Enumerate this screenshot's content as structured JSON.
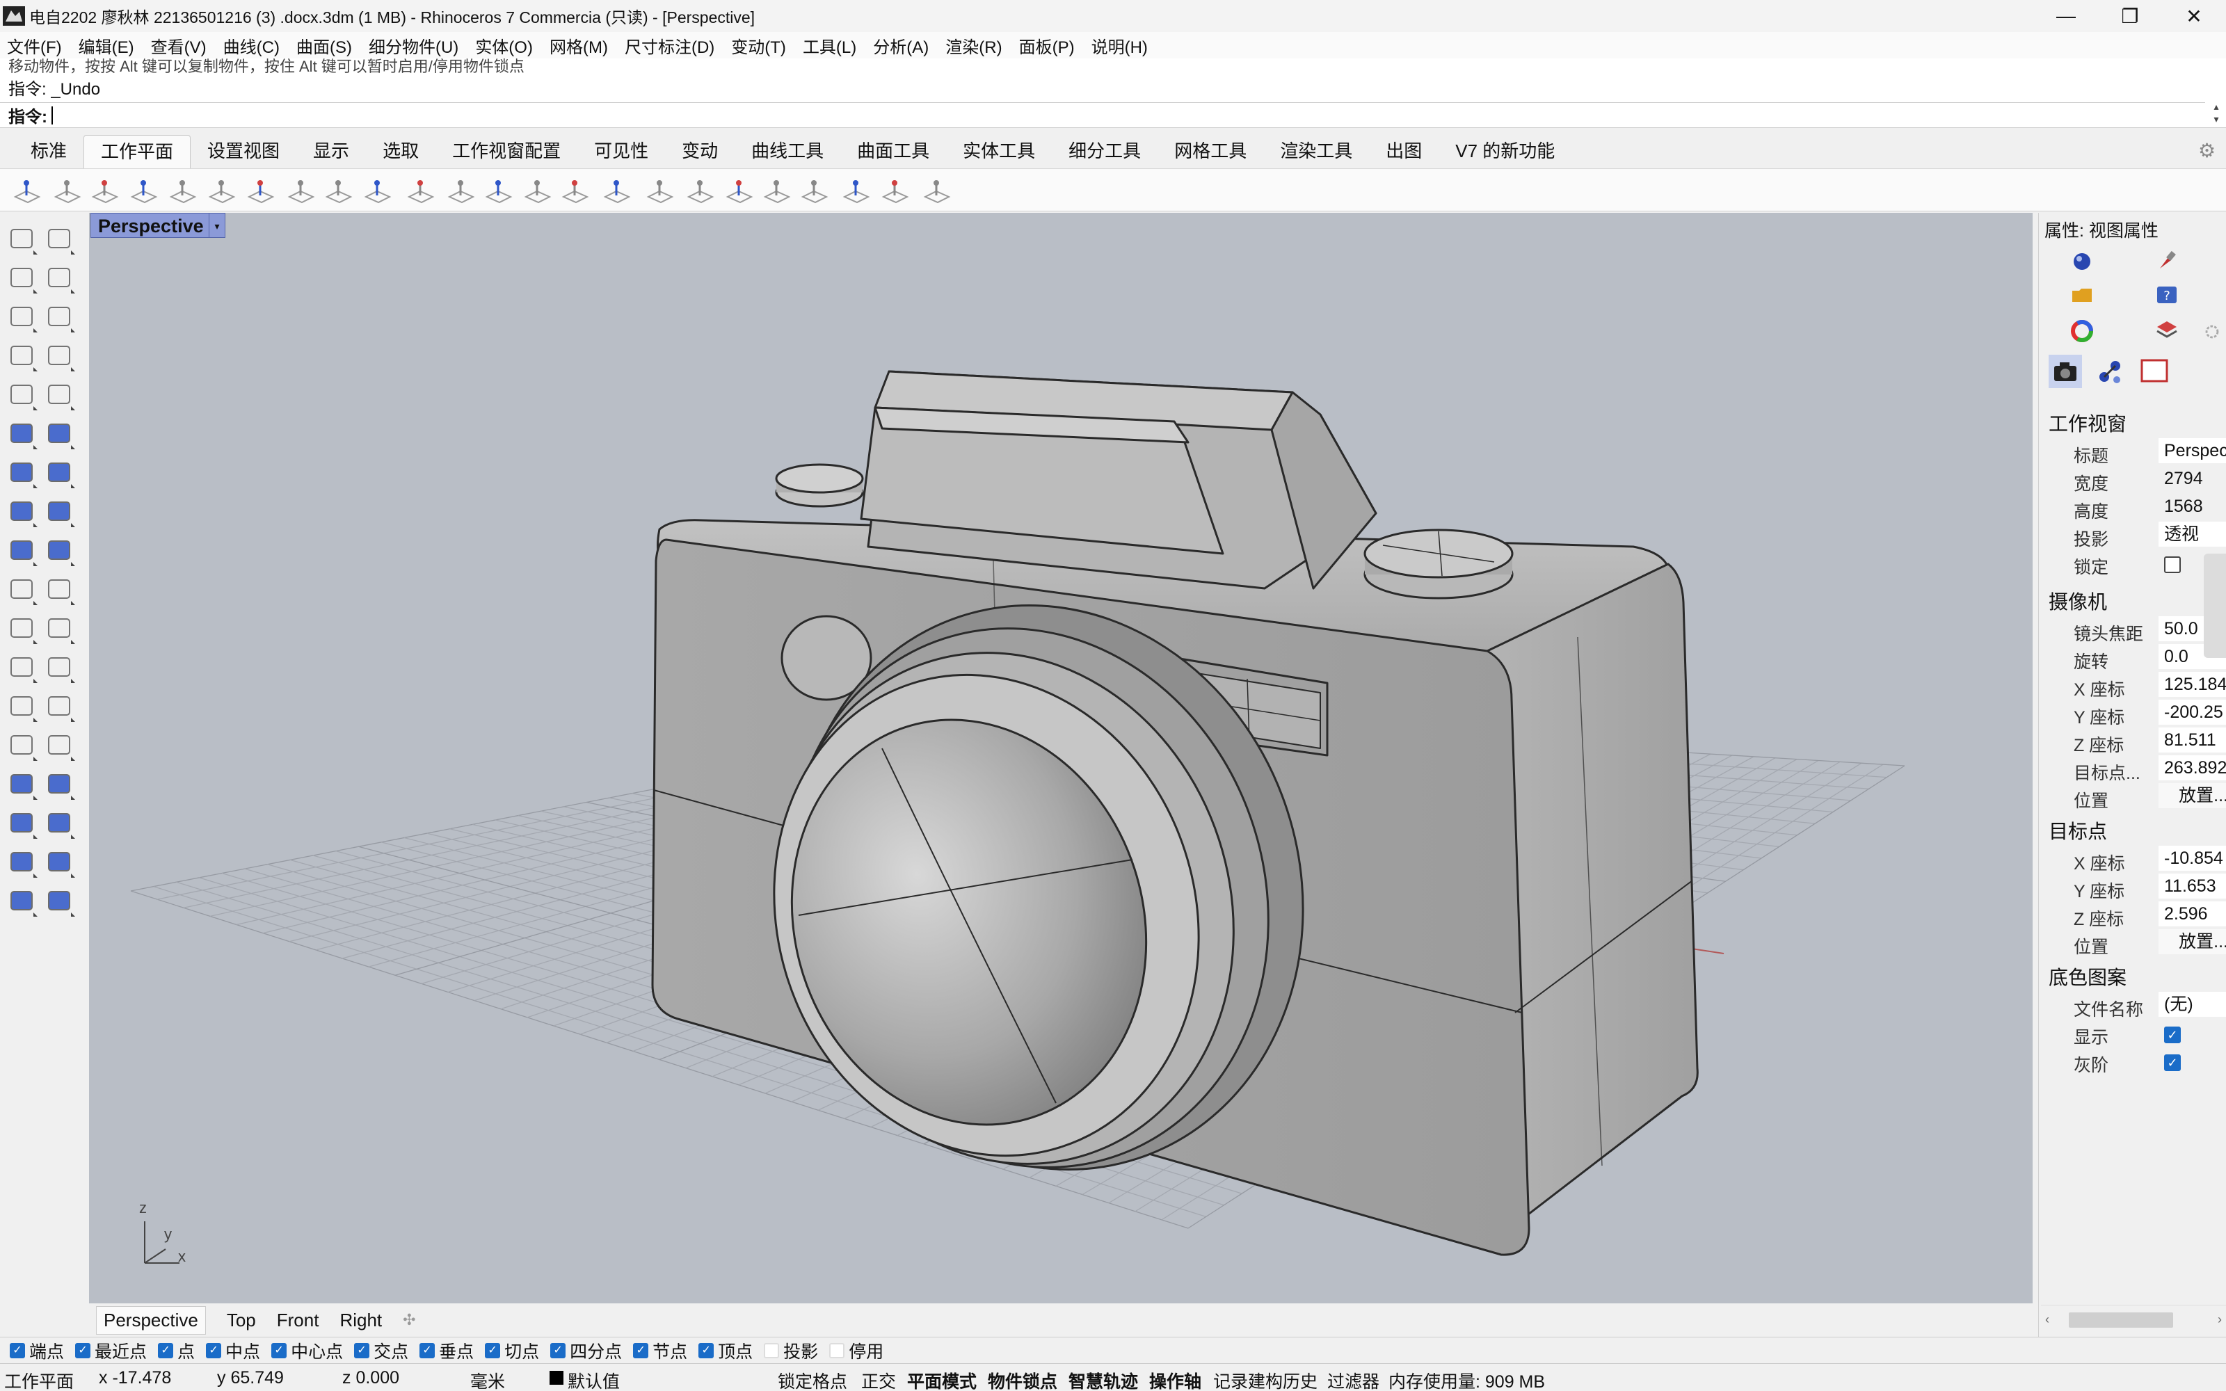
{
  "window": {
    "title": "电自2202 廖秋林 22136501216 (3) .docx.3dm (1 MB) - Rhinoceros 7 Commercia (只读) - [Perspective]",
    "minimize": "—",
    "maximize": "❐",
    "close": "✕"
  },
  "menu": [
    "文件(F)",
    "编辑(E)",
    "查看(V)",
    "曲线(C)",
    "曲面(S)",
    "细分物件(U)",
    "实体(O)",
    "网格(M)",
    "尺寸标注(D)",
    "变动(T)",
    "工具(L)",
    "分析(A)",
    "渲染(R)",
    "面板(P)",
    "说明(H)"
  ],
  "command": {
    "history_partial": "移动物件，按按 Alt 键可以复制物件，按住 Alt 键可以暂时启用/停用物件锁点",
    "history": "指令: _Undo",
    "prompt": "指令:",
    "value": ""
  },
  "toolbar_tabs": [
    "标准",
    "工作平面",
    "设置视图",
    "显示",
    "选取",
    "工作视窗配置",
    "可见性",
    "变动",
    "曲线工具",
    "曲面工具",
    "实体工具",
    "细分工具",
    "网格工具",
    "渲染工具",
    "出图",
    "V7 的新功能"
  ],
  "active_tab": "工作平面",
  "viewport": {
    "title": "Perspective",
    "dropdown": "▾"
  },
  "axes": {
    "z": "z",
    "y": "y",
    "x": "x"
  },
  "viewport_tabs": [
    "Perspective",
    "Top",
    "Front",
    "Right"
  ],
  "viewport_add": "✣",
  "panel": {
    "title": "属性: 视图属性",
    "section_viewport": "工作视窗",
    "viewport_props": [
      {
        "label": "标题",
        "value": "Perspective"
      },
      {
        "label": "宽度",
        "value": "2794"
      },
      {
        "label": "高度",
        "value": "1568"
      },
      {
        "label": "投影",
        "value": "透视"
      }
    ],
    "lock_label": "锁定",
    "section_camera": "摄像机",
    "camera_props": [
      {
        "label": "镜头焦距",
        "value": "50.0"
      },
      {
        "label": "旋转",
        "value": "0.0"
      },
      {
        "label": "X 座标",
        "value": "125.184"
      },
      {
        "label": "Y 座标",
        "value": "-200.25"
      },
      {
        "label": "Z 座标",
        "value": "81.511"
      },
      {
        "label": "目标点...",
        "value": "263.892"
      },
      {
        "label": "位置",
        "value": "放置..."
      }
    ],
    "section_target": "目标点",
    "target_props": [
      {
        "label": "X 座标",
        "value": "-10.854"
      },
      {
        "label": "Y 座标",
        "value": "11.653"
      },
      {
        "label": "Z 座标",
        "value": "2.596"
      },
      {
        "label": "位置",
        "value": "放置..."
      }
    ],
    "section_wallpaper": "底色图案",
    "wallpaper_file_label": "文件名称",
    "wallpaper_file_value": "(无)",
    "wallpaper_show_label": "显示",
    "wallpaper_gray_label": "灰阶"
  },
  "osnaps": [
    {
      "label": "端点",
      "on": true
    },
    {
      "label": "最近点",
      "on": true
    },
    {
      "label": "点",
      "on": true
    },
    {
      "label": "中点",
      "on": true
    },
    {
      "label": "中心点",
      "on": true
    },
    {
      "label": "交点",
      "on": true
    },
    {
      "label": "垂点",
      "on": true
    },
    {
      "label": "切点",
      "on": true
    },
    {
      "label": "四分点",
      "on": true
    },
    {
      "label": "节点",
      "on": true
    },
    {
      "label": "顶点",
      "on": true
    },
    {
      "label": "投影",
      "on": false
    },
    {
      "label": "停用",
      "on": false
    }
  ],
  "status": {
    "cplane": "工作平面",
    "x": "x -17.478",
    "y": "y 65.749",
    "z": "z 0.000",
    "units": "毫米",
    "layer": "默认值",
    "grid_snap": "锁定格点",
    "ortho": "正交",
    "planar": "平面模式",
    "osnap": "物件锁点",
    "smarttrack": "智慧轨迹",
    "gumball": "操作轴",
    "history": "记录建构历史",
    "filter": "过滤器",
    "memory": "内存使用量: 909 MB"
  },
  "colors": {
    "viewport_bg": "#b9bec6",
    "title_active": "#8b9ad8",
    "checkbox": "#1a6cc8"
  }
}
